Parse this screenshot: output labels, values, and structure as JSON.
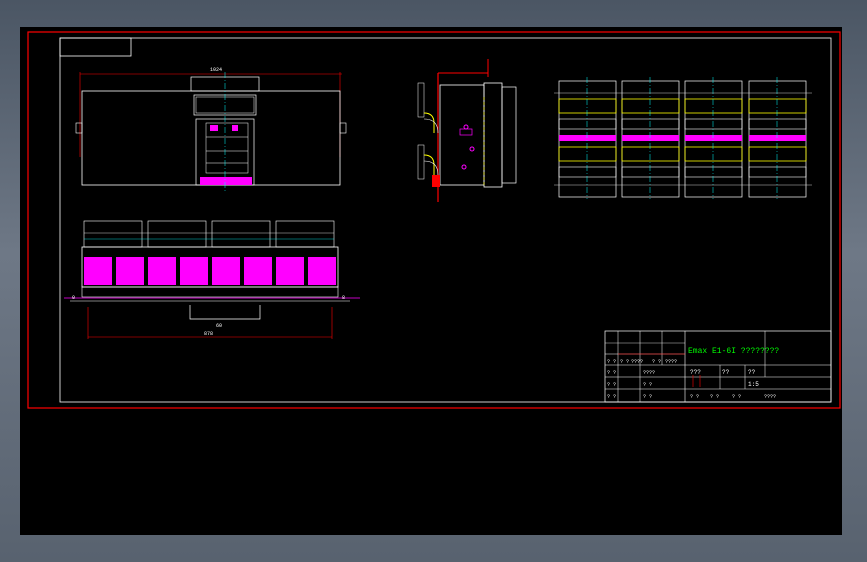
{
  "drawing": {
    "dimension_top": "1024",
    "dimension_bottom": "878",
    "dimension_small": "60",
    "ticks_left": "0",
    "ticks_right": "8"
  },
  "title_block": {
    "title": "Emax E1-6I ????????",
    "row_a": [
      "???",
      "??",
      "??"
    ],
    "scale": "1:5",
    "lower_left": [
      "? ?",
      "? ?",
      "? ?"
    ],
    "lower_mid": [
      "????",
      "? ?",
      "? ?"
    ],
    "footer": [
      "? ?",
      "? ?",
      "? ?",
      "????"
    ],
    "header_small": [
      "? ?",
      "? ?",
      "????",
      "? ?",
      "????"
    ]
  },
  "colors": {
    "background": "#000000",
    "frame": "#ff0000",
    "line": "#ffffff",
    "accent_magenta": "#ff00ff",
    "accent_yellow": "#ffff00",
    "accent_cyan": "#00ffff",
    "title_green": "#00ff00"
  }
}
